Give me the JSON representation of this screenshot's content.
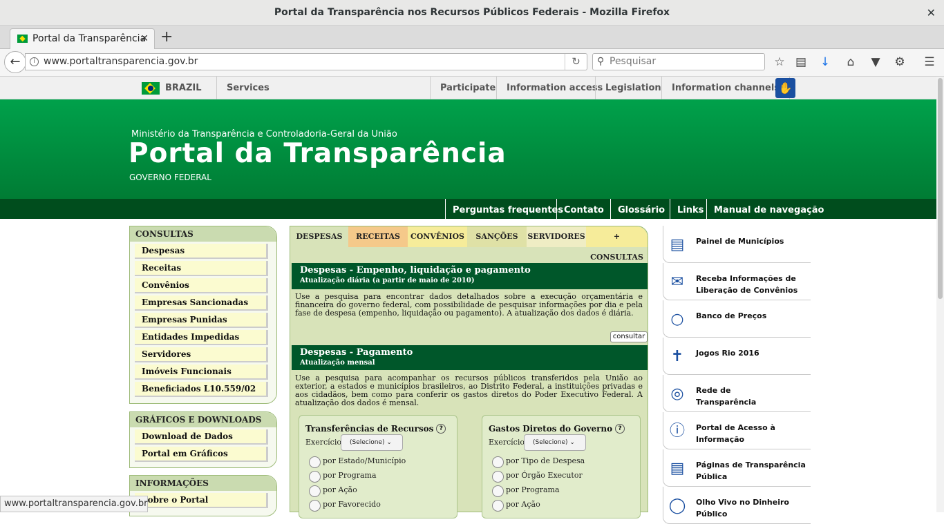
{
  "window": {
    "title": "Portal da Transparência nos Recursos Públicos Federais - Mozilla Firefox",
    "close_glyph": "✕"
  },
  "tab": {
    "label": "Portal da Transparência",
    "close": "✕",
    "new_tab": "+"
  },
  "nav": {
    "url": "www.portaltransparencia.gov.br",
    "search_placeholder": "Pesquisar"
  },
  "govbar": {
    "country": "BRAZIL",
    "services": "Services",
    "participate": "Participate",
    "information_access": "Information access",
    "legislation": "Legislation",
    "information_channels": "Information channels"
  },
  "header": {
    "ministry": "Ministério da Transparência e Controladoria-Geral da União",
    "title": "Portal da Transparência",
    "subtitle": "GOVERNO FEDERAL"
  },
  "top_menu": [
    "Perguntas frequentes",
    "Contato",
    "Glossário",
    "Links",
    "Manual de navegação"
  ],
  "sidebar": {
    "consultas": {
      "title": "CONSULTAS",
      "items": [
        "Despesas",
        "Receitas",
        "Convênios",
        "Empresas Sancionadas",
        "Empresas Punidas",
        "Entidades Impedidas",
        "Servidores",
        "Imóveis Funcionais",
        "Beneficiados L10.559/02"
      ]
    },
    "graficos": {
      "title": "GRÁFICOS E DOWNLOADS",
      "items": [
        "Download de Dados",
        "Portal em Gráficos"
      ]
    },
    "informacoes": {
      "title": "INFORMAÇÕES",
      "items": [
        "Sobre o Portal"
      ]
    }
  },
  "center_tabs": [
    "DESPESAS",
    "RECEITAS",
    "CONVÊNIOS",
    "SANÇÕES",
    "SERVIDORES",
    "+ CONSULTAS"
  ],
  "sections": [
    {
      "title": "Despesas - Empenho, liquidação e pagamento",
      "subtitle": "Atualização diária (a partir de maio de 2010)",
      "description": "Use a pesquisa para encontrar dados detalhados sobre a execução orçamentária e financeira do governo federal, com possibilidade de pesquisar informações por dia e pela fase de despesa (empenho, liquidação ou pagamento). A atualização dos dados é diária.",
      "button": "consultar"
    },
    {
      "title": "Despesas - Pagamento",
      "subtitle": "Atualização mensal",
      "description": "Use a pesquisa para acompanhar os recursos públicos transferidos pela União ao exterior, a estados e municípios brasileiros, ao Distrito Federal, a instituições privadas e aos cidadãos, bem como para conferir os gastos diretos do Poder Executivo Federal. A atualização dos dados é mensal."
    }
  ],
  "panels": [
    {
      "title": "Transferências de Recursos",
      "help": "?",
      "exercicio_label": "Exercício",
      "select_value": "(Selecione)",
      "options": [
        "por Estado/Município",
        "por Programa",
        "por Ação",
        "por Favorecido"
      ]
    },
    {
      "title": "Gastos Diretos do Governo",
      "help": "?",
      "exercicio_label": "Exercício",
      "select_value": "(Selecione)",
      "options": [
        "por Tipo de Despesa",
        "por Órgão Executor",
        "por Programa",
        "por Ação"
      ]
    }
  ],
  "right_links": [
    {
      "label": "Painel de Municípios",
      "icon": "chart-icon"
    },
    {
      "label": "Receba Informações de Liberação de Convênios",
      "icon": "mail-icon"
    },
    {
      "label": "Banco de Preços",
      "icon": "chat-icon"
    },
    {
      "label": "Jogos Rio 2016",
      "icon": "statue-icon"
    },
    {
      "label": "Rede de Transparência",
      "icon": "globe-icon"
    },
    {
      "label": "Portal de Acesso à Informação",
      "icon": "info-icon"
    },
    {
      "label": "Páginas de Transparência Pública",
      "icon": "document-icon"
    },
    {
      "label": "Olho Vivo no Dinheiro Público",
      "icon": "eye-icon"
    }
  ],
  "status_url": "www.portaltransparencia.gov.br"
}
